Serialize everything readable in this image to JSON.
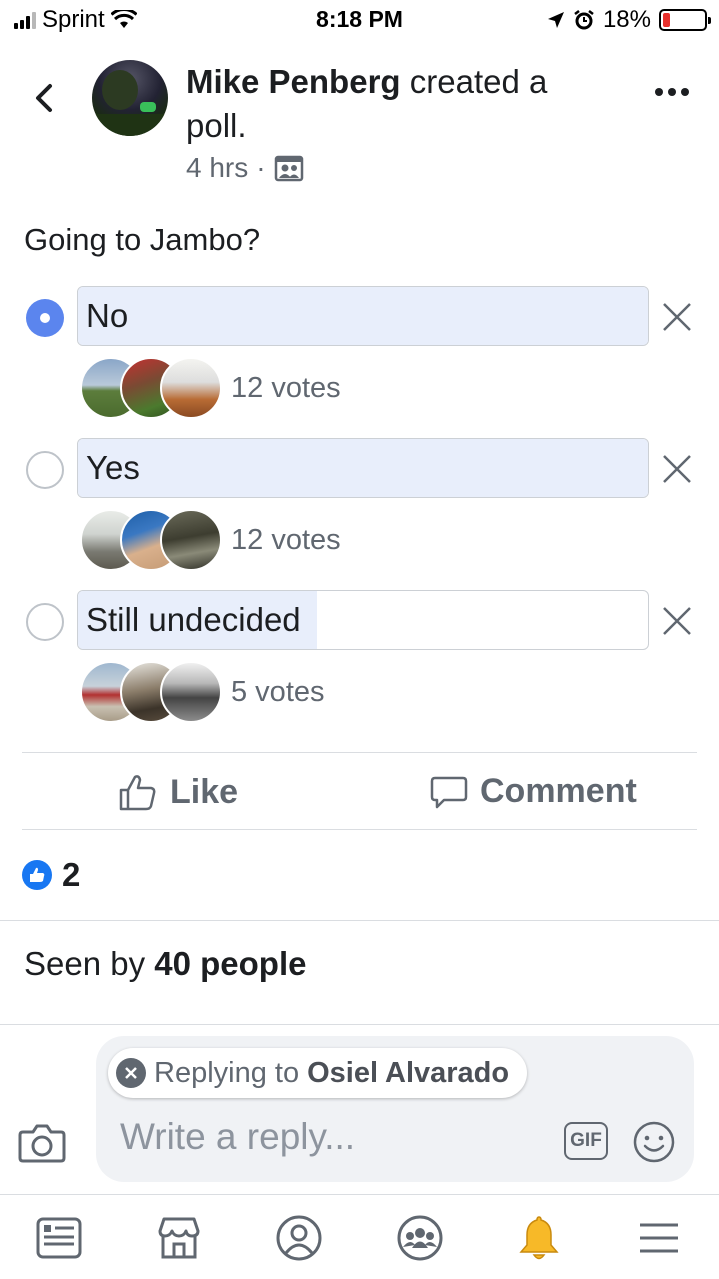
{
  "status_bar": {
    "carrier": "Sprint",
    "time": "8:18 PM",
    "battery": "18%",
    "battery_level": 0.18
  },
  "post": {
    "author": "Mike Penberg",
    "action": " created a poll.",
    "timestamp": "4 hrs",
    "separator": "·",
    "audience_icon": "friends-icon"
  },
  "poll": {
    "question": "Going to Jambo?",
    "options": [
      {
        "label": "No",
        "votes": "12 votes",
        "selected": true,
        "fill": 1.0
      },
      {
        "label": "Yes",
        "votes": "12 votes",
        "selected": false,
        "fill": 1.0
      },
      {
        "label": "Still undecided",
        "votes": "5 votes",
        "selected": false,
        "fill": 0.42
      }
    ]
  },
  "actions": {
    "like_label": "Like",
    "comment_label": "Comment"
  },
  "reactions": {
    "count": "2"
  },
  "seen": {
    "prefix": "Seen by ",
    "count": "40 people"
  },
  "composer": {
    "replying_prefix": "Replying to ",
    "replying_name": "Osiel Alvarado",
    "placeholder": "Write a reply...",
    "gif_label": "GIF"
  },
  "tabbar": {
    "items": [
      "news-feed-icon",
      "marketplace-icon",
      "profile-icon",
      "groups-icon",
      "notifications-icon",
      "menu-icon"
    ],
    "active_color": "#f7b928"
  },
  "colors": {
    "accent": "#5b85ee",
    "like_blue": "#1877f2",
    "muted": "#606770"
  }
}
